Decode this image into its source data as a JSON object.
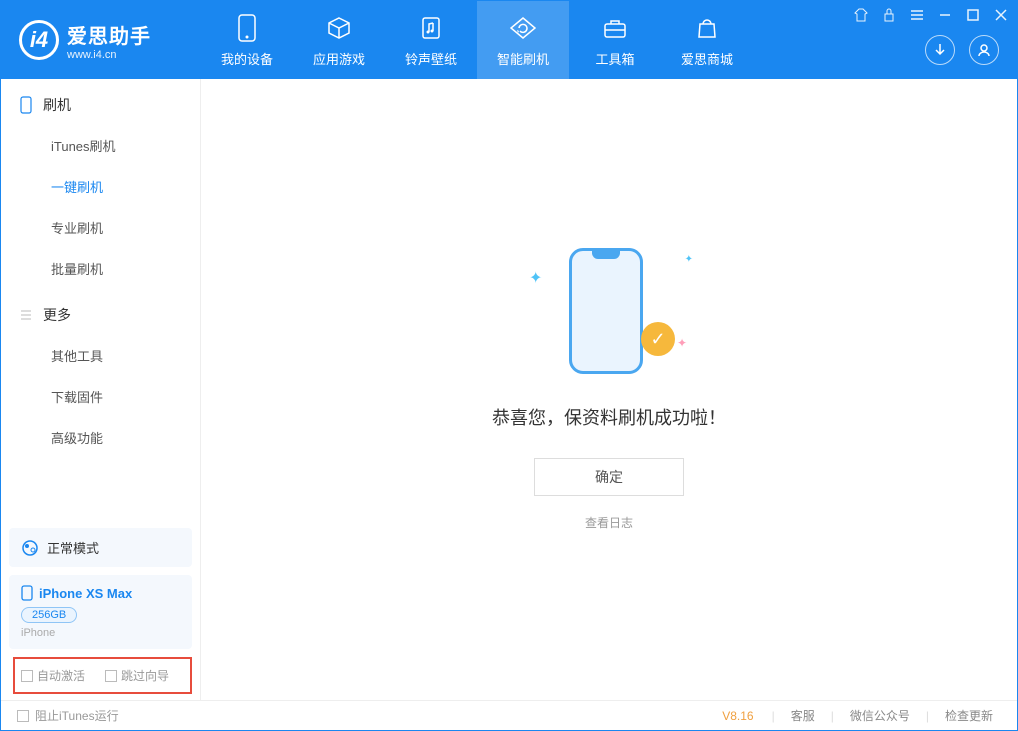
{
  "app": {
    "title": "爱思助手",
    "subtitle": "www.i4.cn"
  },
  "nav": [
    {
      "label": "我的设备",
      "icon": "device"
    },
    {
      "label": "应用游戏",
      "icon": "cube"
    },
    {
      "label": "铃声壁纸",
      "icon": "music"
    },
    {
      "label": "智能刷机",
      "icon": "refresh",
      "active": true
    },
    {
      "label": "工具箱",
      "icon": "toolbox"
    },
    {
      "label": "爱思商城",
      "icon": "bag"
    }
  ],
  "sidebar": {
    "section1_title": "刷机",
    "section1_items": [
      "iTunes刷机",
      "一键刷机",
      "专业刷机",
      "批量刷机"
    ],
    "section1_active_index": 1,
    "section2_title": "更多",
    "section2_items": [
      "其他工具",
      "下载固件",
      "高级功能"
    ]
  },
  "mode_label": "正常模式",
  "device": {
    "name": "iPhone XS Max",
    "capacity": "256GB",
    "type": "iPhone"
  },
  "checkboxes": {
    "auto_activate": "自动激活",
    "skip_guide": "跳过向导"
  },
  "main": {
    "success_text": "恭喜您，保资料刷机成功啦！",
    "ok_button": "确定",
    "view_log": "查看日志"
  },
  "statusbar": {
    "block_itunes": "阻止iTunes运行",
    "version": "V8.16",
    "links": [
      "客服",
      "微信公众号",
      "检查更新"
    ]
  }
}
